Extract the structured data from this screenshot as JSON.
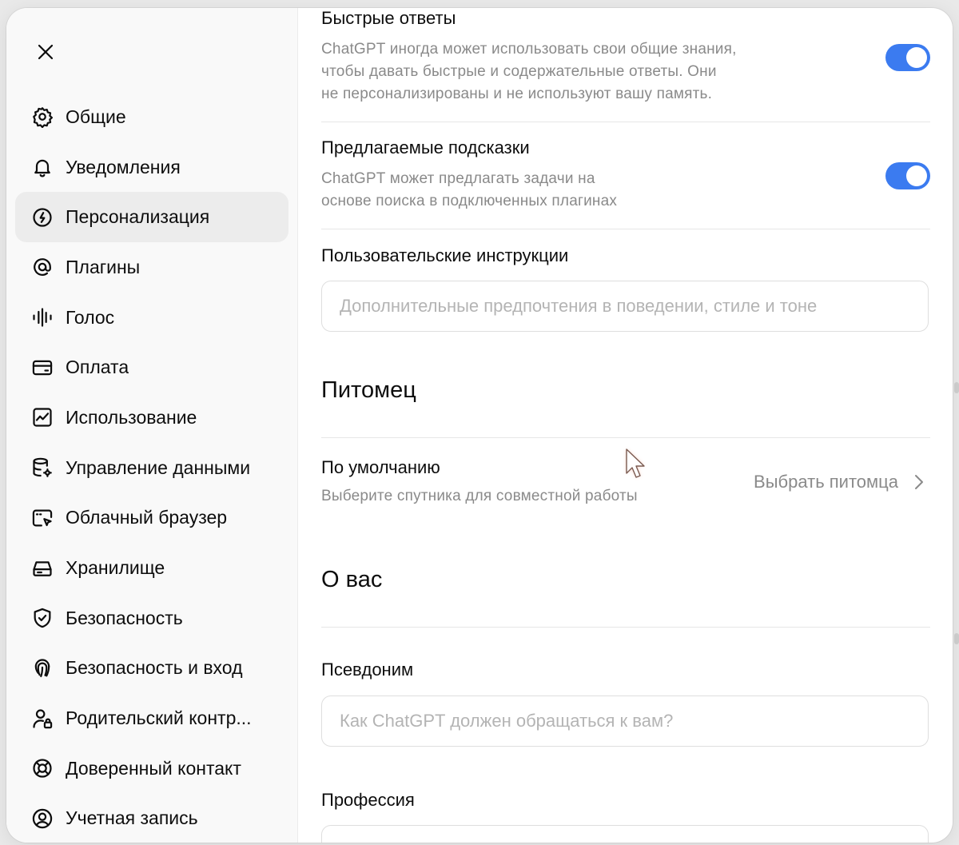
{
  "sidebar": {
    "close_label": "Close",
    "items": [
      {
        "label": "Общие",
        "icon": "gear-icon"
      },
      {
        "label": "Уведомления",
        "icon": "bell-icon"
      },
      {
        "label": "Персонализация",
        "icon": "personalization-icon"
      },
      {
        "label": "Плагины",
        "icon": "at-sign-icon"
      },
      {
        "label": "Голос",
        "icon": "voice-waveform-icon"
      },
      {
        "label": "Оплата",
        "icon": "credit-card-icon"
      },
      {
        "label": "Использование",
        "icon": "usage-chart-icon"
      },
      {
        "label": "Управление данными",
        "icon": "database-gear-icon"
      },
      {
        "label": "Облачный браузер",
        "icon": "cloud-browser-icon"
      },
      {
        "label": "Хранилище",
        "icon": "storage-drive-icon"
      },
      {
        "label": "Безопасность",
        "icon": "shield-check-icon"
      },
      {
        "label": "Безопасность и вход",
        "icon": "fingerprint-icon"
      },
      {
        "label": "Родительский контр...",
        "icon": "parental-user-icon"
      },
      {
        "label": "Доверенный контакт",
        "icon": "lifebuoy-icon"
      },
      {
        "label": "Учетная запись",
        "icon": "account-circle-icon"
      }
    ],
    "active_index": 2
  },
  "settings": {
    "quick_answers": {
      "title": "Быстрые ответы",
      "desc_lines": [
        "ChatGPT иногда может использовать свои общие знания,",
        "чтобы давать быстрые и содержательные ответы. Они",
        "не персонализированы и не используют вашу память."
      ],
      "enabled": true
    },
    "suggested_prompts": {
      "title": "Предлагаемые подсказки",
      "desc_lines": [
        "ChatGPT может предлагать задачи на",
        "основе поиска в подключенных плагинах"
      ],
      "enabled": true
    },
    "custom_instructions": {
      "title": "Пользовательские инструкции",
      "placeholder": "Дополнительные предпочтения в поведении, стиле и тоне",
      "value": ""
    }
  },
  "pet": {
    "heading": "Питомец",
    "default_title": "По умолчанию",
    "default_desc": "Выберите спутника для совместной работы",
    "select_label": "Выбрать питомца"
  },
  "about": {
    "heading": "О вас",
    "nickname": {
      "title": "Псевдоним",
      "placeholder": "Как ChatGPT должен обращаться к вам?",
      "value": ""
    },
    "profession": {
      "title": "Профессия",
      "value": ""
    }
  },
  "colors": {
    "toggle_on": "#3b7bf0",
    "active_nav_bg": "#ececec",
    "muted_text": "#8a8a8a"
  }
}
